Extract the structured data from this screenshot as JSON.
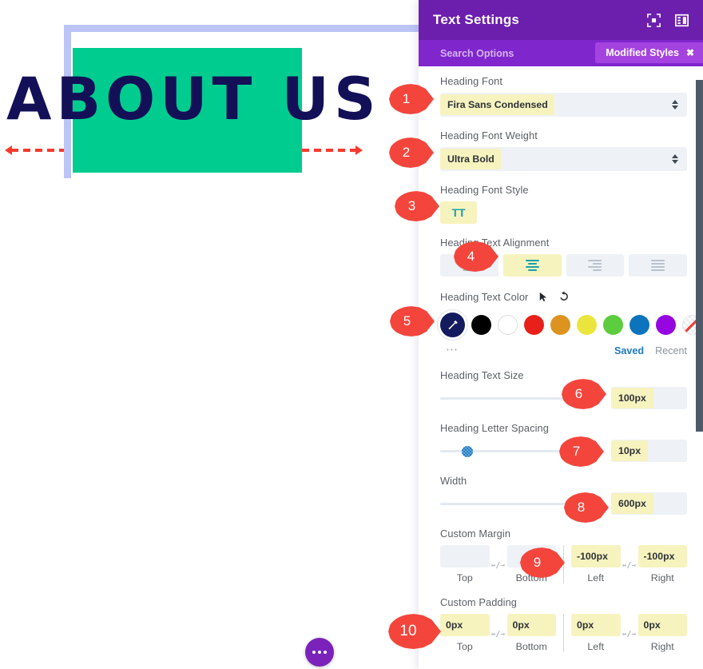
{
  "canvas": {
    "heading_text": "ABOUT US",
    "heading_color": "#131058",
    "block_color": "#00cc8f",
    "row_border_color": "#bcc4f7",
    "arrow_color": "#f7392f",
    "fab_icon": "ellipsis-icon",
    "arrow_left_icon": "arrow-left-dashed-icon",
    "arrow_right_icon": "arrow-right-dashed-icon"
  },
  "panel": {
    "title": "Text Settings",
    "header_color": "#6c1ead",
    "search_bar_color": "#8026cd",
    "icons": {
      "focus": "focus-target-icon",
      "layout": "panel-layout-icon"
    },
    "search": {
      "placeholder": "Search Options",
      "badge_label": "Modified Styles",
      "badge_close": "✖"
    },
    "fields": {
      "heading_font": {
        "label": "Heading Font",
        "value": "Fira Sans Condensed"
      },
      "heading_font_weight": {
        "label": "Heading Font Weight",
        "value": "Ultra Bold"
      },
      "heading_font_style": {
        "label": "Heading Font Style",
        "value": "TT",
        "active": true
      },
      "heading_text_alignment": {
        "label": "Heading Text Alignment",
        "options": [
          "left",
          "center",
          "right",
          "justify"
        ],
        "selected": "center"
      },
      "heading_text_color": {
        "label": "Heading Text Color",
        "selected_swatch": "#141a5e",
        "picker_icon": "eyedropper-icon",
        "cursor_icon": "pointer-icon",
        "reset_icon": "reset-icon",
        "more_icon": "more-dots-icon",
        "swatches": [
          {
            "name": "black",
            "hex": "#000000"
          },
          {
            "name": "white",
            "hex": "#ffffff"
          },
          {
            "name": "red",
            "hex": "#e8201a"
          },
          {
            "name": "orange",
            "hex": "#dd931f"
          },
          {
            "name": "yellow",
            "hex": "#eae53c"
          },
          {
            "name": "green",
            "hex": "#5ccd3f"
          },
          {
            "name": "blue",
            "hex": "#0b74bd"
          },
          {
            "name": "purple",
            "hex": "#9606e0"
          },
          {
            "name": "none",
            "hex": "transparent"
          }
        ],
        "tabs": {
          "saved": "Saved",
          "recent": "Recent"
        }
      },
      "heading_text_size": {
        "label": "Heading Text Size",
        "value": "100px",
        "knob_pct": 0
      },
      "heading_letter_spacing": {
        "label": "Heading Letter Spacing",
        "value": "10px",
        "knob_pct": 13
      },
      "width": {
        "label": "Width",
        "value": "600px",
        "knob_pct": 0
      },
      "custom_margin": {
        "label": "Custom Margin",
        "link_icon": "link-sides-icon",
        "sides": [
          {
            "caption": "Top",
            "value": "",
            "highlighted": false
          },
          {
            "caption": "Bottom",
            "value": "",
            "highlighted": false
          },
          {
            "caption": "Left",
            "value": "-100px",
            "highlighted": true
          },
          {
            "caption": "Right",
            "value": "-100px",
            "highlighted": true
          }
        ]
      },
      "custom_padding": {
        "label": "Custom Padding",
        "link_icon": "link-sides-icon",
        "sides": [
          {
            "caption": "Top",
            "value": "0px",
            "highlighted": true
          },
          {
            "caption": "Bottom",
            "value": "0px",
            "highlighted": true
          },
          {
            "caption": "Left",
            "value": "0px",
            "highlighted": true
          },
          {
            "caption": "Right",
            "value": "0px",
            "highlighted": true
          }
        ]
      }
    },
    "scrollbar": "vertical-scrollbar"
  },
  "markers": [
    {
      "n": "1"
    },
    {
      "n": "2"
    },
    {
      "n": "3"
    },
    {
      "n": "4"
    },
    {
      "n": "5"
    },
    {
      "n": "6"
    },
    {
      "n": "7"
    },
    {
      "n": "8"
    },
    {
      "n": "9"
    },
    {
      "n": "10"
    }
  ]
}
